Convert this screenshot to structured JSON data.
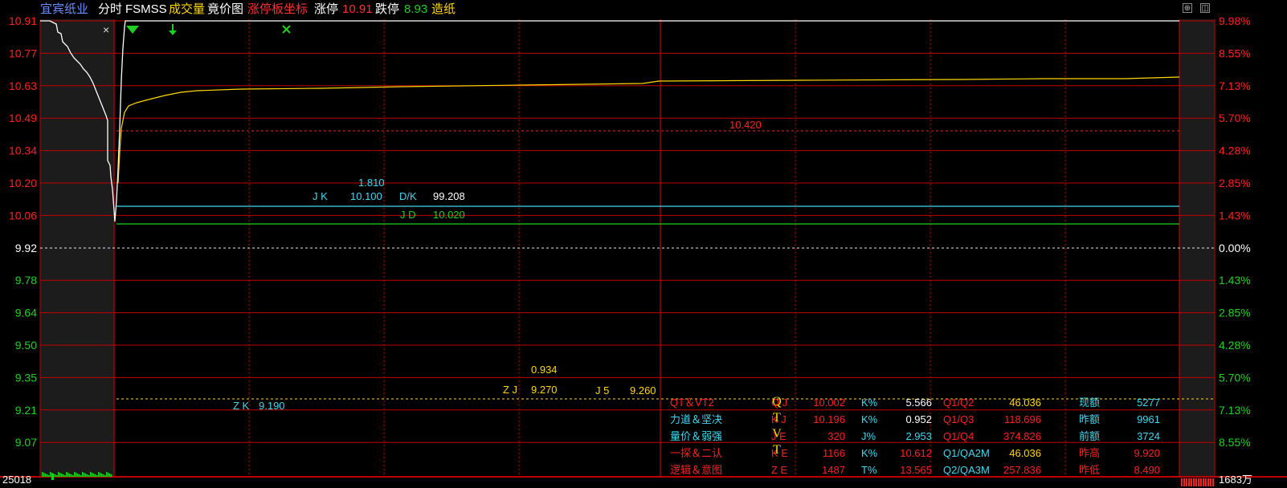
{
  "header": {
    "stock_name": "宜宾纸业",
    "tab_timeshare": "分时",
    "indicator_name": "FSMSS",
    "tab_volume": "成交量",
    "tab_auction": "竟价图",
    "tab_limit_axis": "涨停板坐标",
    "limit_up_label": "涨停",
    "limit_up_value": "10.91",
    "limit_down_label": "跌停",
    "limit_down_value": "8.93",
    "sector": "造纸",
    "btn_expand": "⊕",
    "btn_window": "◫"
  },
  "axes": {
    "left_prices": [
      "10.91",
      "10.77",
      "10.63",
      "10.49",
      "10.34",
      "10.20",
      "10.06",
      "9.92",
      "9.78",
      "9.64",
      "9.50",
      "9.35",
      "9.21",
      "9.07"
    ],
    "right_pcts": [
      "9.98%",
      "8.55%",
      "7.13%",
      "5.70%",
      "4.28%",
      "2.85%",
      "1.43%",
      "0.00%",
      "1.43%",
      "2.85%",
      "4.28%",
      "5.70%",
      "7.13%",
      "8.55%"
    ],
    "left_volume": "25018",
    "right_volume": "1683万"
  },
  "annotations": {
    "level_10420": "10.420",
    "jk_top": "1.810",
    "jk_label": "J K",
    "jk_value": "10.100",
    "dk_label": "D/K",
    "dk_value": "99.208",
    "jd_label": "J D",
    "jd_value": "10.020",
    "zj_top": "0.934",
    "zj_label": "Z J",
    "zj_value": "9.270",
    "j5_label": "J 5",
    "j5_value": "9.260",
    "zk_label": "Z K",
    "zk_value": "9.190",
    "close_mark": "×"
  },
  "stats": {
    "vertical_letters": [
      "Q",
      "T",
      "V",
      "T"
    ],
    "rows": [
      {
        "name": "QT＆VT2",
        "c1": "Q J",
        "v1": "10.002",
        "k1": "K%",
        "kv1": "5.566",
        "q1": "Q1/Q2",
        "qv1": "46.036",
        "n1": "现额",
        "nv1": "5277"
      },
      {
        "name": "力道＆坚决",
        "c1": "K J",
        "v1": "10.196",
        "k1": "K%",
        "kv1": "0.952",
        "q1": "Q1/Q3",
        "qv1": "118.696",
        "n1": "昨额",
        "nv1": "9961"
      },
      {
        "name": "量价＆弱强",
        "c1": "J E",
        "v1": "320",
        "k1": "J%",
        "kv1": "2.953",
        "q1": "Q1/Q4",
        "qv1": "374.826",
        "n1": "前额",
        "nv1": "3724"
      },
      {
        "name": "一探＆二认",
        "c1": "K E",
        "v1": "1166",
        "k1": "K%",
        "kv1": "10.612",
        "q1": "Q1/QA2M",
        "qv1": "46.036",
        "n1": "昨高",
        "nv1": "9.920"
      },
      {
        "name": "逻辑＆意图",
        "c1": "Z E",
        "v1": "1487",
        "k1": "T%",
        "kv1": "13.565",
        "q1": "Q2/QA3M",
        "qv1": "257.836",
        "n1": "昨低",
        "nv1": "8.490"
      }
    ]
  },
  "colors": {
    "background": "#000000",
    "grid_red": "#c00000",
    "price_red": "#ff2020",
    "price_green": "#20d020",
    "avg_yellow": "#ffd800",
    "cyan": "#40d8f0",
    "white": "#ffffff"
  }
}
